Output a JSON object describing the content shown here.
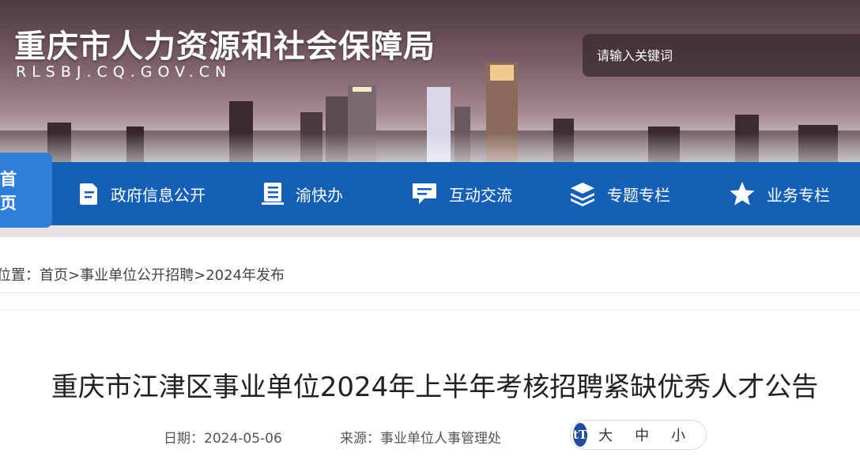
{
  "header": {
    "title": "重庆市人力资源和社会保障局",
    "domain": "RLSBJ.CQ.GOV.CN",
    "search_placeholder": "请输入关键词"
  },
  "nav": {
    "home": "首页",
    "items": [
      {
        "label": "政府信息公开",
        "icon": "document-icon"
      },
      {
        "label": "渝快办",
        "icon": "list-icon"
      },
      {
        "label": "互动交流",
        "icon": "chat-icon"
      },
      {
        "label": "专题专栏",
        "icon": "layers-icon"
      },
      {
        "label": "业务专栏",
        "icon": "star-icon"
      }
    ],
    "colors": {
      "bar": "#1560b5",
      "active": "#2f7fd8"
    }
  },
  "breadcrumb": {
    "prefix": "位置：",
    "items": [
      "首页",
      "事业单位公开招聘",
      "2024年发布"
    ],
    "separator": ">"
  },
  "article": {
    "title": "重庆市江津区事业单位2024年上半年考核招聘紧缺优秀人才公告",
    "date_label": "日期：",
    "date": "2024-05-06",
    "source_label": "来源：",
    "source": "事业单位人事管理处"
  },
  "font_size": {
    "icon_text": "tT",
    "options": [
      "大",
      "中",
      "小"
    ]
  }
}
